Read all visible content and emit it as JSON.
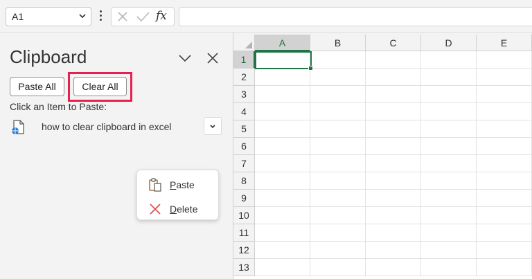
{
  "formula_bar": {
    "name_box": "A1",
    "fx_label": "fx",
    "formula_value": ""
  },
  "clipboard_pane": {
    "title": "Clipboard",
    "paste_all_label": "Paste All",
    "clear_all_label": "Clear All",
    "click_item_label": "Click an Item to Paste:",
    "items": [
      {
        "text": "how to clear clipboard in excel",
        "icon": "web-document-icon"
      }
    ],
    "context_menu": [
      {
        "label": "Paste",
        "icon": "paste-icon"
      },
      {
        "label": "Delete",
        "icon": "delete-x-icon"
      }
    ],
    "highlight_color": "#e8204e"
  },
  "sheet": {
    "columns": [
      "A",
      "B",
      "C",
      "D",
      "E"
    ],
    "rows": [
      "1",
      "2",
      "3",
      "4",
      "5",
      "6",
      "7",
      "8",
      "9",
      "10",
      "11",
      "12",
      "13"
    ],
    "active_cell": "A1",
    "accent_color": "#217346"
  }
}
